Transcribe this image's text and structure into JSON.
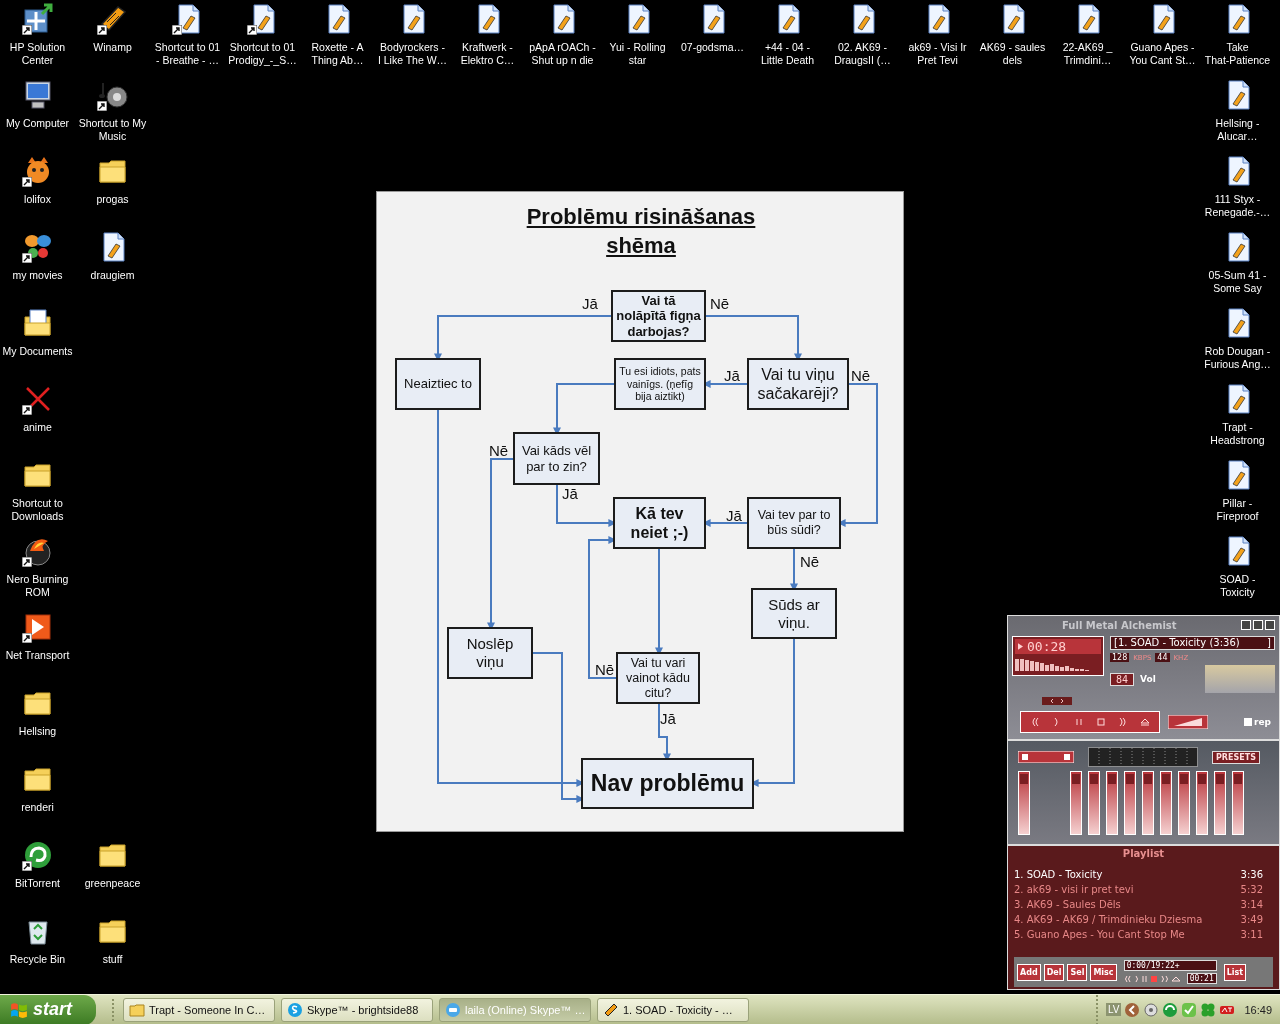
{
  "desktop": {
    "columns": [
      {
        "icons": [
          {
            "kind": "hp",
            "label": [
              "HP Solution",
              "Center"
            ],
            "shortcut": true
          },
          {
            "kind": "computer",
            "label": [
              "My Computer"
            ],
            "shortcut": false
          },
          {
            "kind": "fox",
            "label": [
              "lolifox"
            ],
            "shortcut": true
          },
          {
            "kind": "butterfly",
            "label": [
              "my movies"
            ],
            "shortcut": true
          },
          {
            "kind": "documents",
            "label": [
              "My Documents"
            ],
            "shortcut": false
          },
          {
            "kind": "cross",
            "label": [
              "anime"
            ],
            "shortcut": true
          },
          {
            "kind": "folder",
            "label": [
              "Shortcut to",
              "Downloads"
            ],
            "shortcut": false
          },
          {
            "kind": "nero",
            "label": [
              "Nero Burning",
              "ROM"
            ],
            "shortcut": true
          },
          {
            "kind": "transport",
            "label": [
              "Net Transport"
            ],
            "shortcut": true
          },
          {
            "kind": "folder",
            "label": [
              "Hellsing"
            ],
            "shortcut": false
          },
          {
            "kind": "folder",
            "label": [
              "renderi"
            ],
            "shortcut": false
          },
          {
            "kind": "bittorrent",
            "label": [
              "BitTorrent"
            ],
            "shortcut": true
          },
          {
            "kind": "recycle",
            "label": [
              "Recycle Bin"
            ],
            "shortcut": false
          }
        ]
      },
      {
        "icons": [
          {
            "kind": "winamp",
            "label": [
              "Winamp"
            ],
            "shortcut": true
          },
          {
            "kind": "music",
            "label": [
              "Shortcut to My",
              "Music"
            ],
            "shortcut": true
          },
          {
            "kind": "folder",
            "label": [
              "progas"
            ],
            "shortcut": false
          },
          {
            "kind": "audio",
            "label": [
              "draugiem"
            ],
            "shortcut": false
          }
        ],
        "bottom_icons": [
          {
            "kind": "folder",
            "label": [
              "greenpeace"
            ],
            "shortcut": false
          },
          {
            "kind": "folder",
            "label": [
              "stuff"
            ],
            "shortcut": false
          }
        ]
      },
      {
        "icons": [
          {
            "kind": "audio",
            "label": [
              "Shortcut to 01",
              "- Breathe - …"
            ],
            "shortcut": true
          }
        ]
      },
      {
        "icons": [
          {
            "kind": "audio",
            "label": [
              "Shortcut to 01",
              "Prodigy_-_S…"
            ],
            "shortcut": true
          }
        ]
      },
      {
        "icons": [
          {
            "kind": "audio",
            "label": [
              "Roxette - A",
              "Thing Ab…"
            ],
            "shortcut": false
          }
        ]
      },
      {
        "icons": [
          {
            "kind": "audio",
            "label": [
              "Bodyrockers -",
              "I Like The W…"
            ],
            "shortcut": false
          }
        ]
      },
      {
        "icons": [
          {
            "kind": "audio",
            "label": [
              "Kraftwerk -",
              "Elektro C…"
            ],
            "shortcut": false
          }
        ]
      },
      {
        "icons": [
          {
            "kind": "audio",
            "label": [
              "pApA rOACh -",
              "Shut up n die"
            ],
            "shortcut": false
          }
        ]
      },
      {
        "icons": [
          {
            "kind": "audio",
            "label": [
              "Yui - Rolling",
              "star"
            ],
            "shortcut": false
          }
        ]
      },
      {
        "icons": [
          {
            "kind": "audio",
            "label": [
              "07-godsma…"
            ],
            "shortcut": false
          }
        ]
      },
      {
        "icons": [
          {
            "kind": "audio",
            "label": [
              "+44 - 04 -",
              "Little Death"
            ],
            "shortcut": false
          }
        ]
      },
      {
        "icons": [
          {
            "kind": "audio",
            "label": [
              "02. AK69 -",
              "DraugsII (…"
            ],
            "shortcut": false
          }
        ]
      },
      {
        "icons": [
          {
            "kind": "audio",
            "label": [
              "ak69 - Visi Ir",
              "Pret Tevi"
            ],
            "shortcut": false
          }
        ]
      },
      {
        "icons": [
          {
            "kind": "audio",
            "label": [
              "AK69 - saules",
              "dels"
            ],
            "shortcut": false
          }
        ]
      },
      {
        "icons": [
          {
            "kind": "audio",
            "label": [
              "22-AK69 _",
              "Trimdini…"
            ],
            "shortcut": false
          }
        ]
      },
      {
        "icons": [
          {
            "kind": "audio",
            "label": [
              "Guano Apes -",
              "You Cant St…"
            ],
            "shortcut": false
          }
        ]
      },
      {
        "icons": [
          {
            "kind": "audio",
            "label": [
              "Take",
              "That-Patience"
            ],
            "shortcut": false
          },
          {
            "kind": "audio",
            "label": [
              "Hellsing -",
              "Alucar…"
            ],
            "shortcut": false
          },
          {
            "kind": "audio",
            "label": [
              "111 Styx -",
              "Renegade.-…"
            ],
            "shortcut": false
          },
          {
            "kind": "audio",
            "label": [
              "05-Sum 41 -",
              "Some Say"
            ],
            "shortcut": false
          },
          {
            "kind": "audio",
            "label": [
              "Rob Dougan -",
              "Furious Ang…"
            ],
            "shortcut": false
          },
          {
            "kind": "audio",
            "label": [
              "Trapt -",
              "Headstrong"
            ],
            "shortcut": false
          },
          {
            "kind": "audio",
            "label": [
              "Pillar -",
              "Fireproof"
            ],
            "shortcut": false
          },
          {
            "kind": "audio",
            "label": [
              "SOAD -",
              "Toxicity"
            ],
            "shortcut": false
          }
        ]
      }
    ]
  },
  "flowchart": {
    "title": "Problēmu risināšanas shēma",
    "nodes": [
      {
        "lines": [
          "Vai tā",
          "nolāpītā figņa",
          "darbojas?"
        ],
        "bold": true
      },
      {
        "lines": [
          "Neaiztiec to"
        ],
        "bold": false
      },
      {
        "lines": [
          "Tu esi idiots, pats",
          "vainīgs. (ņefīg",
          "bija aiztikt)"
        ],
        "bold": false
      },
      {
        "lines": [
          "Vai tu viņu",
          "sačakarēji?"
        ],
        "bold": false
      },
      {
        "lines": [
          "Vai kāds vēl",
          "par to zin?"
        ],
        "bold": false
      },
      {
        "lines": [
          "Kā tev",
          "neiet ;-)"
        ],
        "bold": true
      },
      {
        "lines": [
          "Vai tev par to",
          "būs sūdi?"
        ],
        "bold": false
      },
      {
        "lines": [
          "Sūds ar",
          "viņu."
        ],
        "bold": false
      },
      {
        "lines": [
          "Noslēp",
          "viņu"
        ],
        "bold": false
      },
      {
        "lines": [
          "Vai tu vari",
          "vainot kādu",
          "citu?"
        ],
        "bold": false
      },
      {
        "lines": [
          "Nav problēmu"
        ],
        "bold": true
      }
    ],
    "edge_labels": [
      "Jā",
      "Nē",
      "Jā",
      "Nē",
      "Nē",
      "Jā",
      "Jā",
      "Nē",
      "Nē",
      "Jā"
    ]
  },
  "winamp": {
    "title": "Full Metal Alchemist",
    "time": "00:28",
    "song_title": "[1. SOAD - Toxicity (3:36)",
    "song_title_end": "]",
    "bitrate": "128",
    "bitrate_unit": "KBPS",
    "samplerate": "44",
    "samplerate_unit": "KHZ",
    "volume": "84",
    "volume_label": "Vol",
    "repeat": {
      "label": "rep",
      "checked": true
    },
    "equalizer": {
      "presets": "PRESETS",
      "preamp": {
        "level": 0.88
      },
      "bands": [
        {
          "level": 0.88
        },
        {
          "level": 0.88
        },
        {
          "level": 0.88
        },
        {
          "level": 0.88
        },
        {
          "level": 0.88
        },
        {
          "level": 0.88
        },
        {
          "level": 0.88
        },
        {
          "level": 0.88
        },
        {
          "level": 0.88
        },
        {
          "level": 0.88
        }
      ]
    },
    "playlist": {
      "title": "Playlist",
      "items": [
        {
          "title": "1. SOAD - Toxicity",
          "duration": "3:36",
          "selected": true
        },
        {
          "title": "2. ak69 - visi ir pret tevi",
          "duration": "5:32",
          "selected": false
        },
        {
          "title": "3. AK69 - Saules Dēls",
          "duration": "3:14",
          "selected": false
        },
        {
          "title": "4. AK69 - AK69 / Trimdinieku Dziesma",
          "duration": "3:49",
          "selected": false
        },
        {
          "title": "5. Guano Apes - You Cant Stop Me",
          "duration": "3:11",
          "selected": false
        }
      ],
      "buttons": [
        "Add",
        "Del",
        "Sel",
        "Misc"
      ],
      "total_time": "0:00/19:22+",
      "elapsed": "00:21",
      "list_button": "List"
    }
  },
  "taskbar": {
    "start": "start",
    "tasks": [
      {
        "label": "Trapt - Someone In C…",
        "selected": false
      },
      {
        "label": "Skype™ - brightside88",
        "selected": false
      },
      {
        "label": "laila (Online) Skype™ …",
        "selected": true
      },
      {
        "label": "1. SOAD - Toxicity - …",
        "selected": false
      }
    ],
    "language": "LV",
    "clock": "16:49"
  }
}
